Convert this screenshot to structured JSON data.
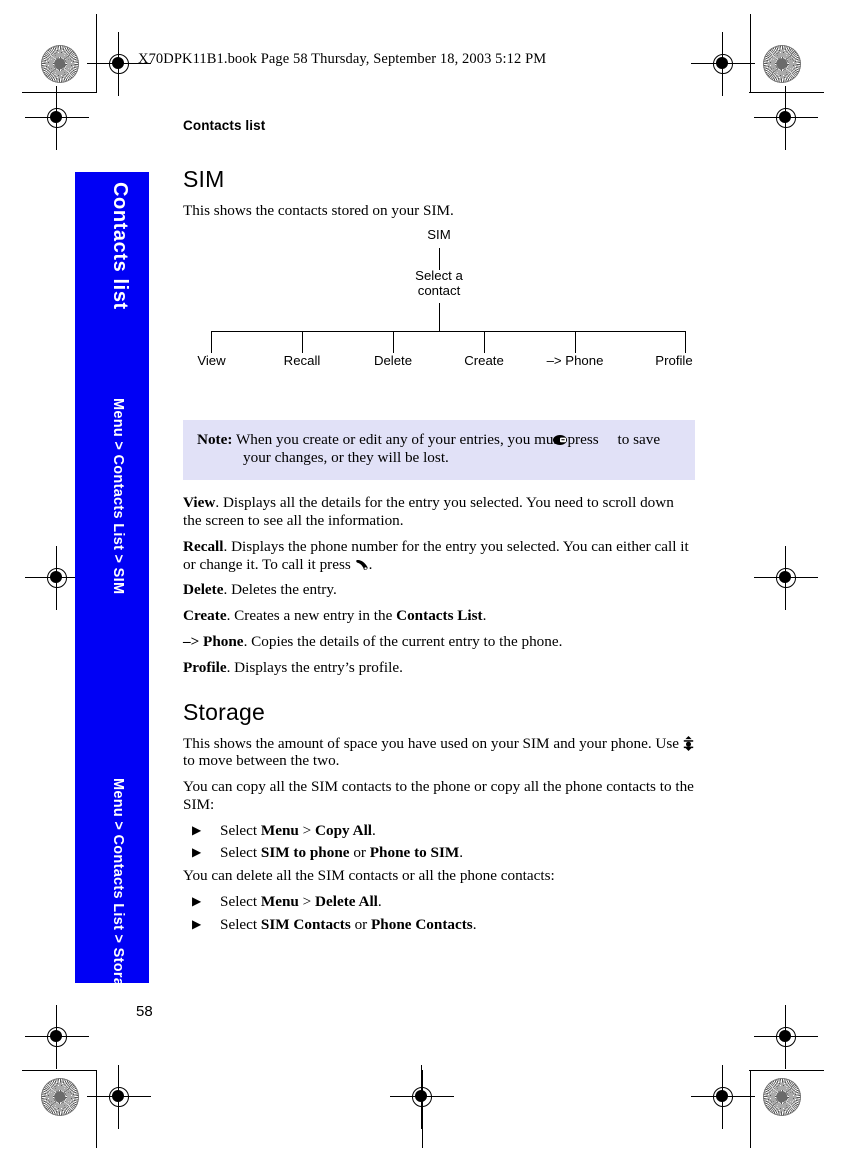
{
  "print_marks": {
    "book_tag": "X70DPK11B1.book  Page 58  Thursday, September 18, 2003  5:12 PM"
  },
  "sidebar": {
    "background_color": "#0000f5",
    "text_color": "#ffffff",
    "title": "Contacts list",
    "path_sim": "Menu > Contacts List > SIM",
    "path_storage": "Menu > Contacts List > Storage"
  },
  "page": {
    "running_head": "Contacts list",
    "page_number": "58"
  },
  "sections": {
    "sim": {
      "heading": "SIM",
      "intro": "This shows the contacts stored on your SIM.",
      "diagram": {
        "root": "SIM",
        "middle_line1": "Select a",
        "middle_line2": "contact",
        "leaves": [
          "View",
          "Recall",
          "Delete",
          "Create",
          "–> Phone",
          "Profile"
        ]
      },
      "note": {
        "label": "Note:",
        "text_before_icon": "When you create or edit any of your entries, you must press",
        "icon": "save-key-icon",
        "text_after_icon": "to save your changes, or they will be lost.",
        "background_color": "#e1e1f7"
      },
      "definitions": [
        {
          "term": "View",
          "text": ". Displays all the details for the entry you selected. You need to scroll down the screen to see all the information."
        },
        {
          "term": "Recall",
          "text_before_icon": ". Displays the phone number for the entry you selected. You can either call it or change it. To call it press ",
          "icon": "call-key-icon",
          "text_after_icon": "."
        },
        {
          "term": "Delete",
          "text": ". Deletes the entry."
        },
        {
          "term": "Create",
          "text_part1": ". Creates a new entry in the ",
          "bold_part": "Contacts List",
          "text_part2": "."
        },
        {
          "term": "–> Phone",
          "text": ". Copies the details of the current entry to the phone."
        },
        {
          "term": "Profile",
          "text": ". Displays the entry’s profile."
        }
      ]
    },
    "storage": {
      "heading": "Storage",
      "intro_before_icon": "This shows the amount of space you have used on your SIM and your phone. Use ",
      "intro_icon": "joystick-up-down-icon",
      "intro_after_icon": " to move between the two.",
      "copy_lead": "You can copy all the SIM contacts to the phone or copy all the phone contacts to the SIM:",
      "copy_steps": [
        {
          "prefix": "Select ",
          "bold1": "Menu",
          "mid": " > ",
          "bold2": "Copy All",
          "suffix": "."
        },
        {
          "prefix": "Select ",
          "bold1": "SIM to phone",
          "mid": " or ",
          "bold2": "Phone to SIM",
          "suffix": "."
        }
      ],
      "delete_lead": "You can delete all the SIM contacts or all the phone contacts:",
      "delete_steps": [
        {
          "prefix": "Select ",
          "bold1": "Menu",
          "mid": " > ",
          "bold2": "Delete All",
          "suffix": "."
        },
        {
          "prefix": "Select ",
          "bold1": "SIM Contacts",
          "mid": " or ",
          "bold2": "Phone Contacts",
          "suffix": "."
        }
      ],
      "bullet_glyph": "▶"
    }
  }
}
